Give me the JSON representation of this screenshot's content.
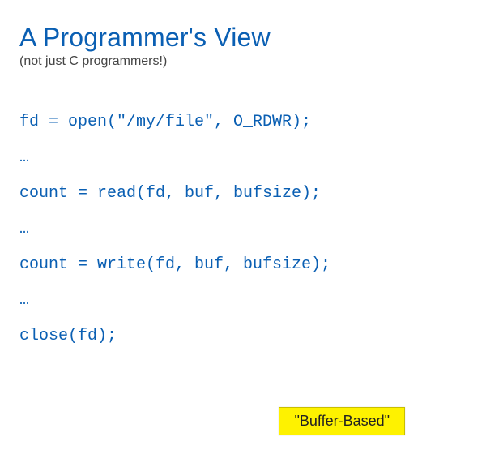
{
  "header": {
    "title": "A Programmer's View",
    "subtitle": "(not just C programmers!)"
  },
  "code": {
    "line1": "fd = open(\"/my/file\", O_RDWR);",
    "ellipsis1": "…",
    "line2": "count = read(fd, buf, bufsize);",
    "ellipsis2": "…",
    "line3": "count = write(fd, buf, bufsize);",
    "ellipsis3": "…",
    "line4": "close(fd);"
  },
  "callout": {
    "label": "\"Buffer-Based\""
  },
  "colors": {
    "primary_blue": "#0a5fb3",
    "highlight_yellow": "#fef200",
    "subtitle_gray": "#444444"
  }
}
